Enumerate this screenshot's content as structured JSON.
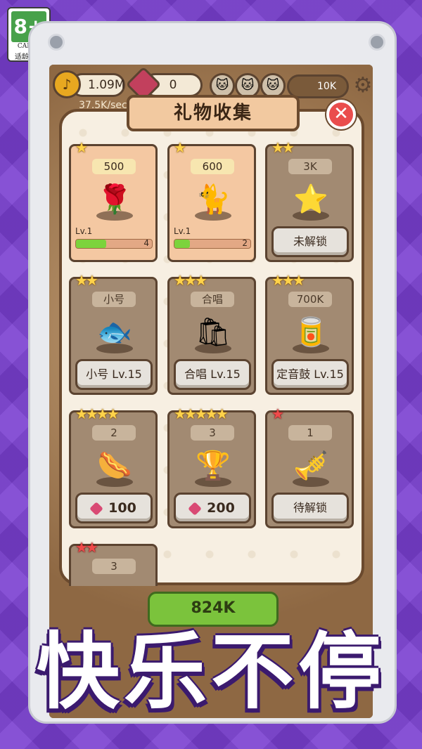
{
  "age_badge": {
    "rating": "8+",
    "org": "CADPA",
    "label": "适龄提示"
  },
  "hud": {
    "coins": "1.09M",
    "gems": "0",
    "rate": "37.5K/sec",
    "cat_count": "10K"
  },
  "panel": {
    "title": "礼物收集",
    "close_icon": "close-icon",
    "cards": [
      {
        "stars": "★",
        "star_color": "gold",
        "price": "500",
        "icon": "rose-icon",
        "level": "Lv.1",
        "progress_count": "4",
        "progress": 0.4,
        "state": "unlocked"
      },
      {
        "stars": "★",
        "star_color": "gold",
        "price": "600",
        "icon": "cat-heart-icon",
        "level": "Lv.1",
        "progress_count": "2",
        "progress": 0.2,
        "state": "unlocked"
      },
      {
        "stars": "★★",
        "star_color": "gold",
        "price": "3K",
        "icon": "star-plush-icon",
        "button": "未解锁",
        "state": "locked"
      },
      {
        "stars": "★★",
        "star_color": "gold",
        "price": "小号",
        "icon": "fish-icon",
        "button": "小号 Lv.15",
        "state": "locked"
      },
      {
        "stars": "★★★",
        "star_color": "gold",
        "price": "合唱",
        "icon": "food-bag-icon",
        "button": "合唱 Lv.15",
        "state": "locked"
      },
      {
        "stars": "★★★",
        "star_color": "gold",
        "price": "700K",
        "icon": "can-icon",
        "button": "定音鼓 Lv.15",
        "state": "locked"
      },
      {
        "stars": "★★★★",
        "star_color": "gold",
        "price": "2",
        "icon": "sausage-icon",
        "button": "100",
        "button_gem": true,
        "state": "locked"
      },
      {
        "stars": "★★★★★",
        "star_color": "gold",
        "price": "3",
        "icon": "trophy-icon",
        "button": "200",
        "button_gem": true,
        "state": "locked"
      },
      {
        "stars": "★",
        "star_color": "red",
        "price": "1",
        "icon": "trumpet-icon",
        "button": "待解锁",
        "state": "locked"
      },
      {
        "stars": "★★",
        "star_color": "red",
        "price": "3",
        "icon": "",
        "state": "locked"
      }
    ]
  },
  "bottom_button": "824K",
  "slogan": "快乐不停",
  "colors": {
    "background": "#7a3fd1",
    "panel": "#f7efe2",
    "card_unlocked": "#f4c8a2",
    "card_locked": "#a28a72",
    "progress": "#7cd33c",
    "close": "#ea4d4d"
  }
}
